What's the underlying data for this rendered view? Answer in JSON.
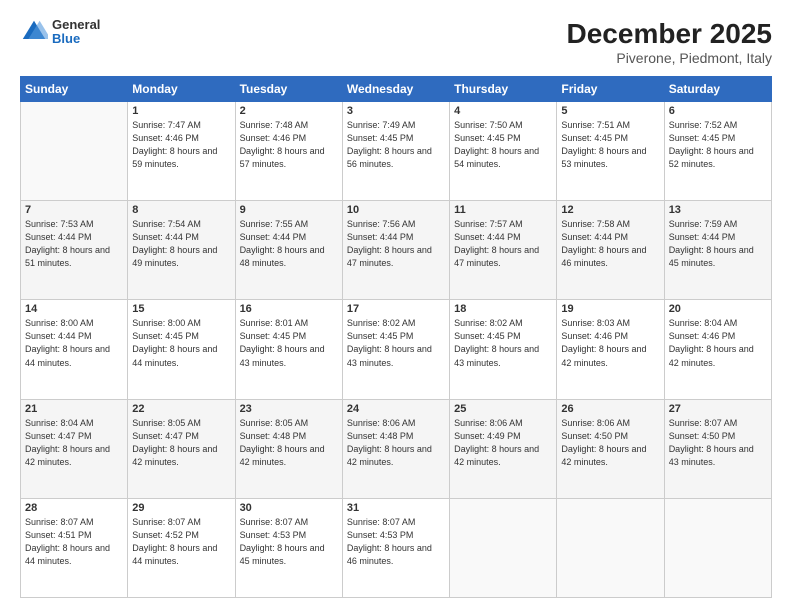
{
  "header": {
    "logo": {
      "general": "General",
      "blue": "Blue"
    },
    "title": "December 2025",
    "subtitle": "Piverone, Piedmont, Italy"
  },
  "weekdays": [
    "Sunday",
    "Monday",
    "Tuesday",
    "Wednesday",
    "Thursday",
    "Friday",
    "Saturday"
  ],
  "weeks": [
    [
      {
        "day": "",
        "empty": true
      },
      {
        "day": "1",
        "sunrise": "7:47 AM",
        "sunset": "4:46 PM",
        "daylight": "8 hours and 59 minutes."
      },
      {
        "day": "2",
        "sunrise": "7:48 AM",
        "sunset": "4:46 PM",
        "daylight": "8 hours and 57 minutes."
      },
      {
        "day": "3",
        "sunrise": "7:49 AM",
        "sunset": "4:45 PM",
        "daylight": "8 hours and 56 minutes."
      },
      {
        "day": "4",
        "sunrise": "7:50 AM",
        "sunset": "4:45 PM",
        "daylight": "8 hours and 54 minutes."
      },
      {
        "day": "5",
        "sunrise": "7:51 AM",
        "sunset": "4:45 PM",
        "daylight": "8 hours and 53 minutes."
      },
      {
        "day": "6",
        "sunrise": "7:52 AM",
        "sunset": "4:45 PM",
        "daylight": "8 hours and 52 minutes."
      }
    ],
    [
      {
        "day": "7",
        "sunrise": "7:53 AM",
        "sunset": "4:44 PM",
        "daylight": "8 hours and 51 minutes."
      },
      {
        "day": "8",
        "sunrise": "7:54 AM",
        "sunset": "4:44 PM",
        "daylight": "8 hours and 49 minutes."
      },
      {
        "day": "9",
        "sunrise": "7:55 AM",
        "sunset": "4:44 PM",
        "daylight": "8 hours and 48 minutes."
      },
      {
        "day": "10",
        "sunrise": "7:56 AM",
        "sunset": "4:44 PM",
        "daylight": "8 hours and 47 minutes."
      },
      {
        "day": "11",
        "sunrise": "7:57 AM",
        "sunset": "4:44 PM",
        "daylight": "8 hours and 47 minutes."
      },
      {
        "day": "12",
        "sunrise": "7:58 AM",
        "sunset": "4:44 PM",
        "daylight": "8 hours and 46 minutes."
      },
      {
        "day": "13",
        "sunrise": "7:59 AM",
        "sunset": "4:44 PM",
        "daylight": "8 hours and 45 minutes."
      }
    ],
    [
      {
        "day": "14",
        "sunrise": "8:00 AM",
        "sunset": "4:44 PM",
        "daylight": "8 hours and 44 minutes."
      },
      {
        "day": "15",
        "sunrise": "8:00 AM",
        "sunset": "4:45 PM",
        "daylight": "8 hours and 44 minutes."
      },
      {
        "day": "16",
        "sunrise": "8:01 AM",
        "sunset": "4:45 PM",
        "daylight": "8 hours and 43 minutes."
      },
      {
        "day": "17",
        "sunrise": "8:02 AM",
        "sunset": "4:45 PM",
        "daylight": "8 hours and 43 minutes."
      },
      {
        "day": "18",
        "sunrise": "8:02 AM",
        "sunset": "4:45 PM",
        "daylight": "8 hours and 43 minutes."
      },
      {
        "day": "19",
        "sunrise": "8:03 AM",
        "sunset": "4:46 PM",
        "daylight": "8 hours and 42 minutes."
      },
      {
        "day": "20",
        "sunrise": "8:04 AM",
        "sunset": "4:46 PM",
        "daylight": "8 hours and 42 minutes."
      }
    ],
    [
      {
        "day": "21",
        "sunrise": "8:04 AM",
        "sunset": "4:47 PM",
        "daylight": "8 hours and 42 minutes."
      },
      {
        "day": "22",
        "sunrise": "8:05 AM",
        "sunset": "4:47 PM",
        "daylight": "8 hours and 42 minutes."
      },
      {
        "day": "23",
        "sunrise": "8:05 AM",
        "sunset": "4:48 PM",
        "daylight": "8 hours and 42 minutes."
      },
      {
        "day": "24",
        "sunrise": "8:06 AM",
        "sunset": "4:48 PM",
        "daylight": "8 hours and 42 minutes."
      },
      {
        "day": "25",
        "sunrise": "8:06 AM",
        "sunset": "4:49 PM",
        "daylight": "8 hours and 42 minutes."
      },
      {
        "day": "26",
        "sunrise": "8:06 AM",
        "sunset": "4:50 PM",
        "daylight": "8 hours and 42 minutes."
      },
      {
        "day": "27",
        "sunrise": "8:07 AM",
        "sunset": "4:50 PM",
        "daylight": "8 hours and 43 minutes."
      }
    ],
    [
      {
        "day": "28",
        "sunrise": "8:07 AM",
        "sunset": "4:51 PM",
        "daylight": "8 hours and 44 minutes."
      },
      {
        "day": "29",
        "sunrise": "8:07 AM",
        "sunset": "4:52 PM",
        "daylight": "8 hours and 44 minutes."
      },
      {
        "day": "30",
        "sunrise": "8:07 AM",
        "sunset": "4:53 PM",
        "daylight": "8 hours and 45 minutes."
      },
      {
        "day": "31",
        "sunrise": "8:07 AM",
        "sunset": "4:53 PM",
        "daylight": "8 hours and 46 minutes."
      },
      {
        "day": "",
        "empty": true
      },
      {
        "day": "",
        "empty": true
      },
      {
        "day": "",
        "empty": true
      }
    ]
  ]
}
